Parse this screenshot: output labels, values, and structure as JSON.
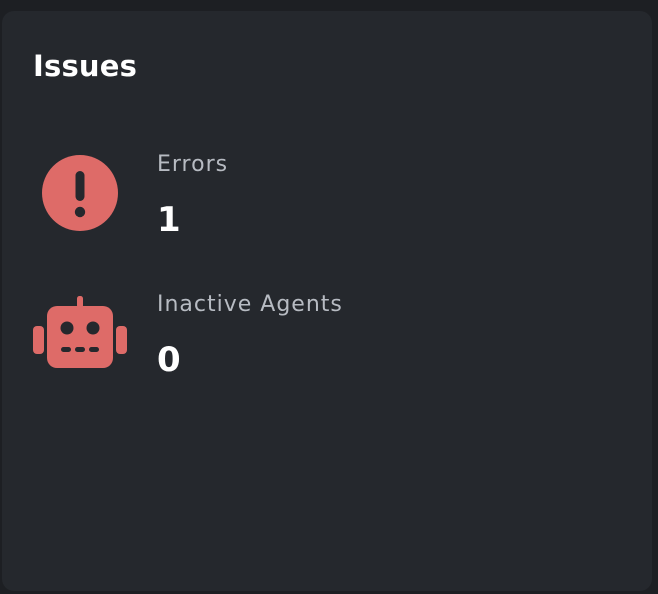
{
  "card": {
    "title": "Issues"
  },
  "stats": [
    {
      "label": "Errors",
      "value": "1",
      "icon": "error-alert-icon",
      "color": "#de6b68"
    },
    {
      "label": "Inactive Agents",
      "value": "0",
      "icon": "robot-icon",
      "color": "#de6b68"
    }
  ],
  "colors": {
    "background": "#1d1f23",
    "card": "#25282d",
    "title": "#ffffff",
    "label": "#b7bbc2",
    "accent": "#de6b68"
  }
}
